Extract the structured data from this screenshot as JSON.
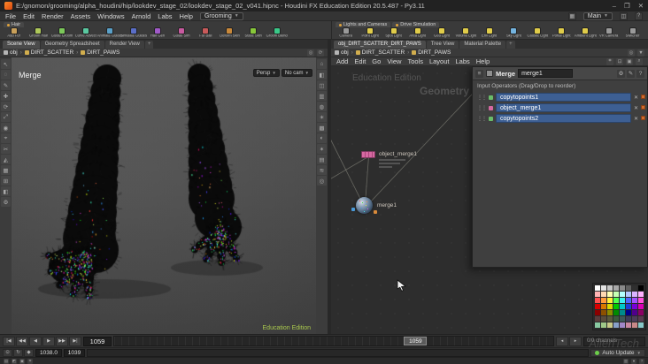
{
  "title_bar": {
    "title": "E:/gnomon/grooming/alpha_houdini/hip/lookdev_stage_02/lookdev_stage_02_v041.hipnc - Houdini FX Education Edition 20.5.487 - Py3.11",
    "minimize": "–",
    "maximize": "❐",
    "close": "✕"
  },
  "menu_bar": {
    "items": [
      "File",
      "Edit",
      "Render",
      "Assets",
      "Windows",
      "Arnold",
      "Labs",
      "Help"
    ],
    "mode": "Grooming",
    "desktop": "Main"
  },
  "shelf": {
    "left_tab": "Hair",
    "right_tabs": [
      "Lights and Cameras",
      "Drive Simulation"
    ],
    "left_tools": [
      {
        "label": "Add Fur",
        "color": "#c9a05a"
      },
      {
        "label": "Groom Hair",
        "color": "#aec85a"
      },
      {
        "label": "Guide Groom",
        "color": "#7cc85a"
      },
      {
        "label": "Curve Advect",
        "color": "#5ac8a0"
      },
      {
        "label": "Animate Guides",
        "color": "#5aa0c8"
      },
      {
        "label": "Simulate Guides",
        "color": "#5a6ec8"
      },
      {
        "label": "Hair Gen",
        "color": "#a05ac8"
      },
      {
        "label": "Guide Sim",
        "color": "#c85aa0"
      },
      {
        "label": "Fur Ball",
        "color": "#c85a5a"
      },
      {
        "label": "Deform Skin",
        "color": "#c8883a"
      },
      {
        "label": "Static Skin",
        "color": "#88c83a"
      },
      {
        "label": "Groom Blend",
        "color": "#3ac888"
      }
    ],
    "right_tools": [
      {
        "label": "Camera",
        "color": "#9a9a9a"
      },
      {
        "label": "Point Light",
        "color": "#e0cc4a"
      },
      {
        "label": "Spot Light",
        "color": "#e0cc4a"
      },
      {
        "label": "Area Light",
        "color": "#e0cc4a"
      },
      {
        "label": "Geo Light",
        "color": "#e0cc4a"
      },
      {
        "label": "Volume Light",
        "color": "#e0cc4a"
      },
      {
        "label": "Env Light",
        "color": "#e0cc4a"
      },
      {
        "label": "Sky Light",
        "color": "#74b4e0"
      },
      {
        "label": "Caustic Light",
        "color": "#e0cc4a"
      },
      {
        "label": "Portal Light",
        "color": "#e0cc4a"
      },
      {
        "label": "Ambient Light",
        "color": "#e0cc4a"
      },
      {
        "label": "VR Camera",
        "color": "#9a9a9a"
      },
      {
        "label": "Switcher",
        "color": "#9a9a9a"
      }
    ]
  },
  "left_pane": {
    "tabs": [
      "Scene View",
      "Geometry Spreadsheet",
      "Render View"
    ],
    "path": [
      {
        "label": "obj",
        "color": "#b5b5b5"
      },
      {
        "label": "DIRT_SCATTER",
        "color": "#d2ae4e"
      },
      {
        "label": "DIRT_PAWS",
        "color": "#d2ae4e"
      }
    ],
    "toolbar_left": [
      {
        "name": "select-icon",
        "glyph": "↖"
      },
      {
        "name": "lasso-select-icon",
        "glyph": "◌"
      },
      {
        "name": "brush-select-icon",
        "glyph": "✎"
      },
      {
        "name": "translate-icon",
        "glyph": "✚"
      },
      {
        "name": "rotate-icon",
        "glyph": "⟳"
      },
      {
        "name": "scale-icon",
        "glyph": "⤢"
      },
      {
        "name": "pose-icon",
        "glyph": "◉"
      },
      {
        "name": "snap-icon",
        "glyph": "⌖"
      },
      {
        "name": "cut-icon",
        "glyph": "✂"
      },
      {
        "name": "sculpt-icon",
        "glyph": "◭"
      },
      {
        "name": "grid-icon",
        "glyph": "▦"
      },
      {
        "name": "measure-icon",
        "glyph": "⊞"
      },
      {
        "name": "handles-icon",
        "glyph": "◧"
      },
      {
        "name": "options-icon",
        "glyph": "⚙"
      }
    ],
    "toolbar_right": [
      {
        "name": "home-view-icon",
        "glyph": "⌂"
      },
      {
        "name": "shade-mode-icon",
        "glyph": "◧"
      },
      {
        "name": "wireframe-icon",
        "glyph": "◫"
      },
      {
        "name": "display-points-icon",
        "glyph": "▥"
      },
      {
        "name": "display-normals-icon",
        "glyph": "◍"
      },
      {
        "name": "lighting-icon",
        "glyph": "☀"
      },
      {
        "name": "background-icon",
        "glyph": "▩"
      },
      {
        "name": "shadows-icon",
        "glyph": "◐"
      },
      {
        "name": "material-icon",
        "glyph": "✶"
      },
      {
        "name": "view-grid-icon",
        "glyph": "▤"
      },
      {
        "name": "fog-icon",
        "glyph": "≋"
      },
      {
        "name": "snapshot-icon",
        "glyph": "◎"
      }
    ],
    "viewport": {
      "display_label": "Merge",
      "persp_selector": "Persp",
      "cam_selector": "No cam",
      "watermark": "Education Edition"
    }
  },
  "right_pane": {
    "tabs": [
      "obj_DIRT_SCATTER_DIRT_PAWS",
      "Tree View",
      "Material Palette"
    ],
    "path": [
      {
        "label": "obj",
        "color": "#b5b5b5"
      },
      {
        "label": "DIRT_SCATTER",
        "color": "#d2ae4e"
      },
      {
        "label": "DIRT_PAWS",
        "color": "#d2ae4e"
      }
    ],
    "network_menu": [
      "Add",
      "Edit",
      "Go",
      "View",
      "Tools",
      "Layout",
      "Labs",
      "Help"
    ],
    "toolbar_icons": [
      {
        "name": "snap-grid-icon",
        "glyph": "⌗"
      },
      {
        "name": "frame-all-icon",
        "glyph": "⊡"
      },
      {
        "name": "overview-icon",
        "glyph": "▣"
      },
      {
        "name": "find-icon",
        "glyph": "⌕"
      }
    ],
    "watermark_edition": "Education Edition",
    "watermark_context": "Geometry",
    "nodes": {
      "object_merge_label": "object_merge1",
      "merge_label": "merge1"
    },
    "params": {
      "type_label": "Merge",
      "name_value": "merge1",
      "section_label": "Input Operators (Drag/Drop to reorder)",
      "inputs": [
        {
          "label": "copytopoints1",
          "icon_color": "#69bd69"
        },
        {
          "label": "object_merge1",
          "icon_color": "#d668a2"
        },
        {
          "label": "copytopoints2",
          "icon_color": "#69bd69"
        }
      ]
    },
    "palette_colors": [
      "#ffffff",
      "#e3e3e3",
      "#c6c6c6",
      "#a8a8a8",
      "#8a8a8a",
      "#5f5f5f",
      "#2f2f2f",
      "#000000",
      "#ffb3b3",
      "#ffd9b3",
      "#ffffb3",
      "#c6ffb3",
      "#b3ffff",
      "#b3c6ff",
      "#d9b3ff",
      "#ffb3ff",
      "#ff5050",
      "#ff9b3c",
      "#fff03c",
      "#50ff50",
      "#3cf0f0",
      "#5064ff",
      "#a050ff",
      "#ff50d9",
      "#d90000",
      "#d97800",
      "#d9d900",
      "#00c800",
      "#00c8c8",
      "#1e3cd9",
      "#7800d9",
      "#d900b4",
      "#8c0000",
      "#8c5000",
      "#8c8c00",
      "#008c00",
      "#008c8c",
      "#00008c",
      "#50008c",
      "#8c0064",
      "#593c3c",
      "#594c3c",
      "#59593c",
      "#3c593c",
      "#3c5959",
      "#3c3c59",
      "#4c3c59",
      "#593c50",
      "#88c8a0",
      "#a0c888",
      "#c8c888",
      "#88a0c8",
      "#a088c8",
      "#c888a0",
      "#c88888",
      "#88c8c8"
    ]
  },
  "playbar": {
    "transport": [
      {
        "name": "jump-start-button",
        "glyph": "|◀"
      },
      {
        "name": "play-reverse-button",
        "glyph": "◀◀"
      },
      {
        "name": "step-back-button",
        "glyph": "◀"
      },
      {
        "name": "play-button",
        "glyph": "▶"
      },
      {
        "name": "step-forward-button",
        "glyph": "▶▶"
      },
      {
        "name": "jump-end-button",
        "glyph": "▶|"
      }
    ],
    "current_frame": "1059",
    "playhead_frame": "1059",
    "playhead_pct": 66,
    "track_arrows": [
      {
        "name": "range-left-icon",
        "glyph": "◂"
      },
      {
        "name": "range-right-icon",
        "glyph": "▸"
      }
    ],
    "scoped_channels": "0/0 channels",
    "range_icons": [
      {
        "name": "realtime-toggle-icon",
        "glyph": "⊙"
      },
      {
        "name": "loop-mode-icon",
        "glyph": "↻"
      },
      {
        "name": "keyframe-options-icon",
        "glyph": "◆"
      }
    ],
    "range_start": "1038.0",
    "range_end": "1039",
    "auto_update_label": "Auto Update"
  },
  "status_bar": {
    "left_icons": [
      {
        "name": "message-log-icon",
        "glyph": "▤"
      },
      {
        "name": "select-mode-icon",
        "glyph": "◩"
      },
      {
        "name": "snap-status-icon",
        "glyph": "▣"
      },
      {
        "name": "grid-status-icon",
        "glyph": "⌗"
      }
    ],
    "right_icons": [
      {
        "name": "memory-icon",
        "glyph": "▥"
      },
      {
        "name": "cook-status-icon",
        "glyph": "●"
      },
      {
        "name": "help-status-icon",
        "glyph": "?"
      }
    ]
  },
  "overlay_watermark": "AlienTech"
}
